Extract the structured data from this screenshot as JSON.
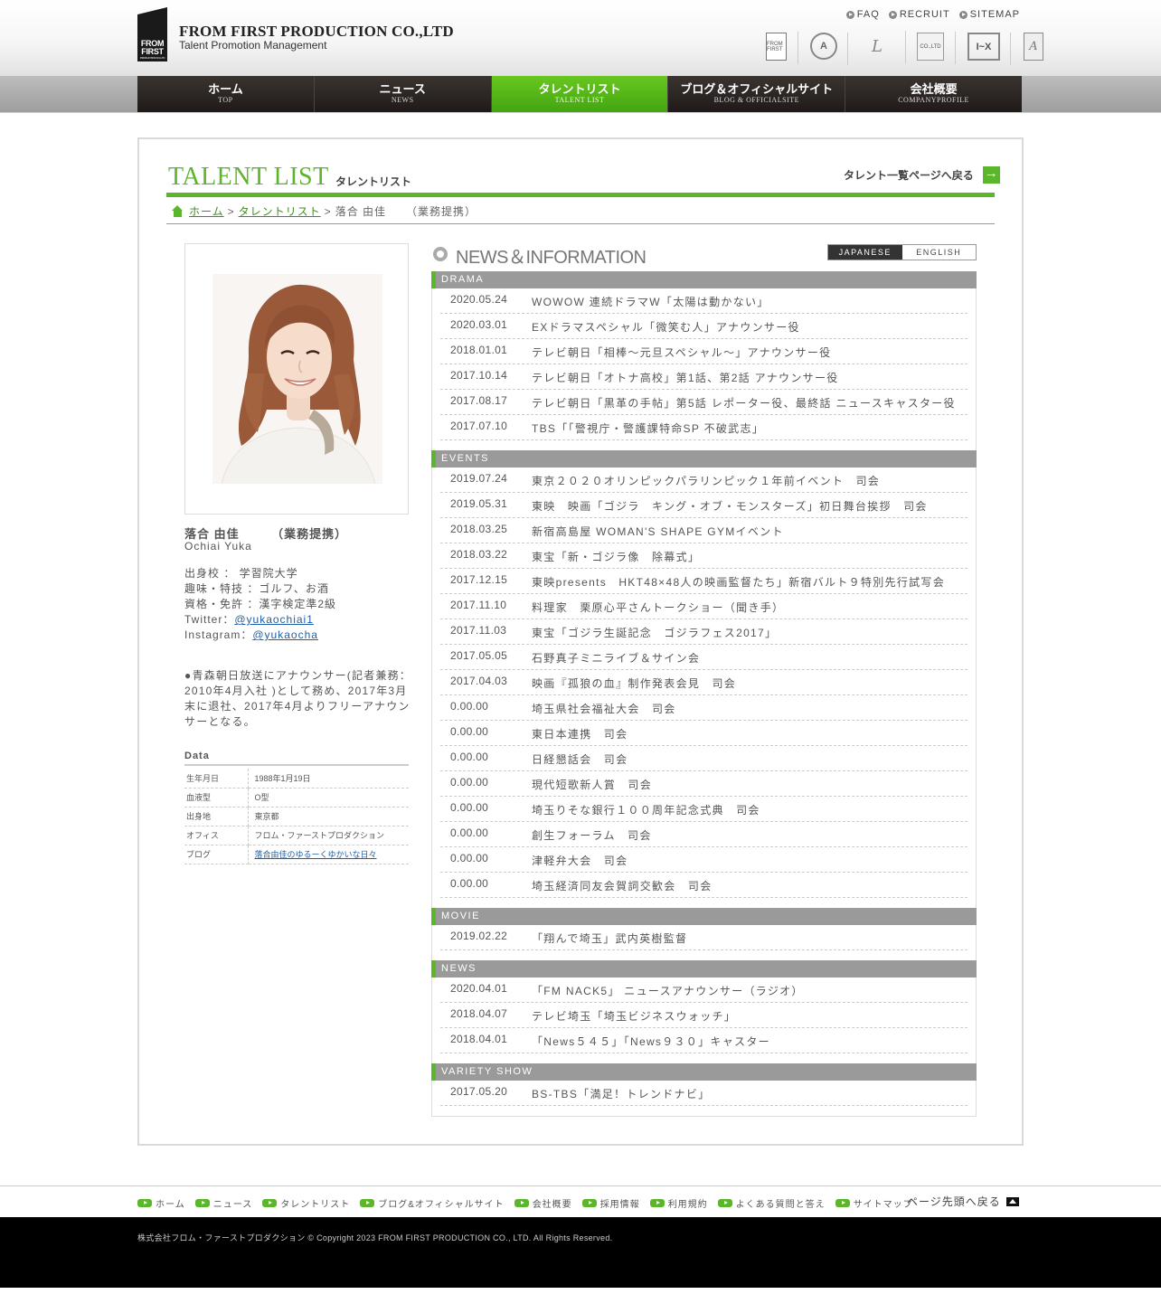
{
  "header": {
    "logo_line1": "FROM",
    "logo_line2": "FIRST",
    "logo_line3": "PRODUCTION CO.,LTD",
    "company_name": "FROM FIRST PRODUCTION CO.,LTD",
    "company_sub": "Talent Promotion Management",
    "top_links": [
      "FAQ",
      "RECRUIT",
      "SITEMAP"
    ],
    "brand_icons": [
      "from-first-brand-icon",
      "emblem-brand-icon",
      "script-logo-brand-icon",
      "book-brand-icon",
      "ix-brand-icon",
      "a-brand-icon"
    ],
    "brand_labels": {
      "b1": "FROM FIRST",
      "b2": "A",
      "b3": "L",
      "b4": "CO.,LTD",
      "b5": "I~X",
      "b6": "A"
    }
  },
  "nav": [
    {
      "jp": "ホーム",
      "en": "TOP"
    },
    {
      "jp": "ニュース",
      "en": "NEWS"
    },
    {
      "jp": "タレントリスト",
      "en": "TALENT LIST"
    },
    {
      "jp": "ブログ＆オフィシャルサイト",
      "en": "BLOG & OFFICIALSITE"
    },
    {
      "jp": "会社概要",
      "en": "COMPANYPROFILE"
    }
  ],
  "active_nav": "タレントリスト",
  "page": {
    "title_en": "TALENT LIST",
    "title_jp": "タレントリスト",
    "back_to_list": "タレント一覧ページへ戻る"
  },
  "breadcrumb": {
    "home": "ホーム",
    "sep": ">",
    "talent_list": "タレントリスト",
    "current": "落合 由佳",
    "current_note": "（業務提携）"
  },
  "profile": {
    "name": "落合 由佳　　　（業務提携）",
    "name_en": "Ochiai Yuka",
    "school": "出身校 ： 学習院大学",
    "hobby": "趣味・特技 ：ゴルフ、お酒",
    "license": "資格・免許 ：漢字検定準2級",
    "twitter_label": "Twitter：",
    "twitter": "@yukaochiai1",
    "instagram_label": "Instagram：",
    "instagram": "@yukaocha",
    "bio": "●青森朝日放送にアナウンサー(記者兼務：2010年4月入社 )として務め、2017年3月末に退社、2017年4月よりフリーアナウンサーとなる。"
  },
  "data_table": {
    "title": "Data",
    "rows": [
      {
        "label": "生年月日",
        "value": "1988年1月19日"
      },
      {
        "label": "血液型",
        "value": "O型"
      },
      {
        "label": "出身地",
        "value": "東京都"
      },
      {
        "label": "オフィス",
        "value": "フロム・ファーストプロダクション"
      },
      {
        "label": "ブログ",
        "value": "落合由佳のゆるーくゆかいな日々"
      }
    ]
  },
  "news": {
    "title": "NEWS＆INFORMATION",
    "lang_japanese": "JAPANESE",
    "lang_english": "ENGLISH",
    "categories": [
      {
        "name": "DRAMA",
        "items": [
          {
            "date": "2020.05.24",
            "text": "WOWOW 連続ドラマW「太陽は動かない」"
          },
          {
            "date": "2020.03.01",
            "text": "EXドラマスペシャル「微笑む人」アナウンサー役"
          },
          {
            "date": "2018.01.01",
            "text": "テレビ朝日「相棒～元旦スペシャル～」アナウンサー役"
          },
          {
            "date": "2017.10.14",
            "text": "テレビ朝日「オトナ高校」第1話、第2話 アナウンサー役"
          },
          {
            "date": "2017.08.17",
            "text": "テレビ朝日「黒革の手帖」第5話 レポーター役、最終話 ニュースキャスター役"
          },
          {
            "date": "2017.07.10",
            "text": "TBS「「警視庁・警護課特命SP 不破武志」"
          }
        ]
      },
      {
        "name": "EVENTS",
        "items": [
          {
            "date": "2019.07.24",
            "text": "東京２０２０オリンピックパラリンピック１年前イベント　司会"
          },
          {
            "date": "2019.05.31",
            "text": "東映　映画「ゴジラ　キング・オブ・モンスターズ」初日舞台挨拶　司会"
          },
          {
            "date": "2018.03.25",
            "text": "新宿高島屋 WOMAN'S SHAPE GYMイベント"
          },
          {
            "date": "2018.03.22",
            "text": "東宝「新・ゴジラ像　除幕式」"
          },
          {
            "date": "2017.12.15",
            "text": "東映presents　HKT48×48人の映画監督たち」新宿バルト９特別先行試写会"
          },
          {
            "date": "2017.11.10",
            "text": "料理家　栗原心平さんトークショー（聞き手）"
          },
          {
            "date": "2017.11.03",
            "text": "東宝「ゴジラ生誕記念　ゴジラフェス2017」"
          },
          {
            "date": "2017.05.05",
            "text": "石野真子ミニライブ＆サイン会"
          },
          {
            "date": "2017.04.03",
            "text": "映画『孤狼の血』制作発表会見　司会"
          },
          {
            "date": "0.00.00",
            "text": "埼玉県社会福祉大会　司会"
          },
          {
            "date": "0.00.00",
            "text": "東日本連携　司会"
          },
          {
            "date": "0.00.00",
            "text": "日経懇話会　司会"
          },
          {
            "date": "0.00.00",
            "text": "現代短歌新人賞　司会"
          },
          {
            "date": "0.00.00",
            "text": "埼玉りそな銀行１００周年記念式典　司会"
          },
          {
            "date": "0.00.00",
            "text": "創生フォーラム　司会"
          },
          {
            "date": "0.00.00",
            "text": "津軽弁大会　司会"
          },
          {
            "date": "0.00.00",
            "text": "埼玉経済同友会賀詞交歓会　司会"
          }
        ]
      },
      {
        "name": "MOVIE",
        "items": [
          {
            "date": "2019.02.22",
            "text": "「翔んで埼玉」武内英樹監督"
          }
        ]
      },
      {
        "name": "NEWS",
        "items": [
          {
            "date": "2020.04.01",
            "text": "「FM NACK5」 ニュースアナウンサー（ラジオ）"
          },
          {
            "date": "2018.04.07",
            "text": "テレビ埼玉「埼玉ビジネスウォッチ」"
          },
          {
            "date": "2018.04.01",
            "text": "「News５４５」「News９３０」キャスター"
          }
        ]
      },
      {
        "name": "VARIETY SHOW",
        "items": [
          {
            "date": "2017.05.20",
            "text": "BS-TBS「満足！トレンドナビ」"
          }
        ]
      }
    ]
  },
  "footer": {
    "links": [
      "ホーム",
      "ニュース",
      "タレントリスト",
      "ブログ&オフィシャルサイト",
      "会社概要",
      "採用情報",
      "利用規約",
      "よくある質問と答え",
      "サイトマップ"
    ],
    "page_top": "ページ先頭へ戻る",
    "copyright": "株式会社フロム・ファーストプロダクション © Copyright 2023 FROM FIRST PRODUCTION CO., LTD. All Rights Reserved."
  },
  "colors": {
    "accent": "#5cb62b",
    "nav_dark": "#2a2421",
    "category_bg": "#9a9a9a",
    "footer_bg": "#000000"
  }
}
